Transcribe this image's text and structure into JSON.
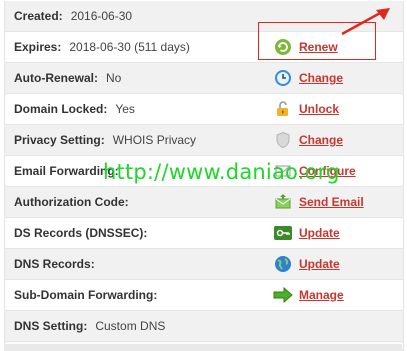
{
  "rows": [
    {
      "label": "Created:",
      "value": "2016-06-30",
      "action": ""
    },
    {
      "label": "Expires:",
      "value": "2018-06-30 (511 days)",
      "action": "Renew",
      "icon": "renew-icon"
    },
    {
      "label": "Auto-Renewal:",
      "value": "No",
      "action": "Change",
      "icon": "clock-icon"
    },
    {
      "label": "Domain Locked:",
      "value": "Yes",
      "action": "Unlock",
      "icon": "unlock-icon"
    },
    {
      "label": "Privacy Setting:",
      "value": "WHOIS Privacy",
      "action": "Change",
      "icon": "shield-icon"
    },
    {
      "label": "Email Forwarding:",
      "value": "",
      "action": "Configure",
      "icon": "email-icon"
    },
    {
      "label": "Authorization Code:",
      "value": "",
      "action": "Send Email",
      "icon": "send-email-icon"
    },
    {
      "label": "DS Records (DNSSEC):",
      "value": "",
      "action": "Update",
      "icon": "key-icon"
    },
    {
      "label": "DNS Records:",
      "value": "",
      "action": "Update",
      "icon": "globe-icon"
    },
    {
      "label": "Sub-Domain Forwarding:",
      "value": "",
      "action": "Manage",
      "icon": "arrow-right-icon"
    },
    {
      "label": "DNS Setting:",
      "value": "Custom DNS",
      "action": ""
    }
  ],
  "watermark": "http://www.daniao.org",
  "colors": {
    "link": "#c7372f",
    "highlight": "#e0281e",
    "watermark": "#1fd62a"
  }
}
